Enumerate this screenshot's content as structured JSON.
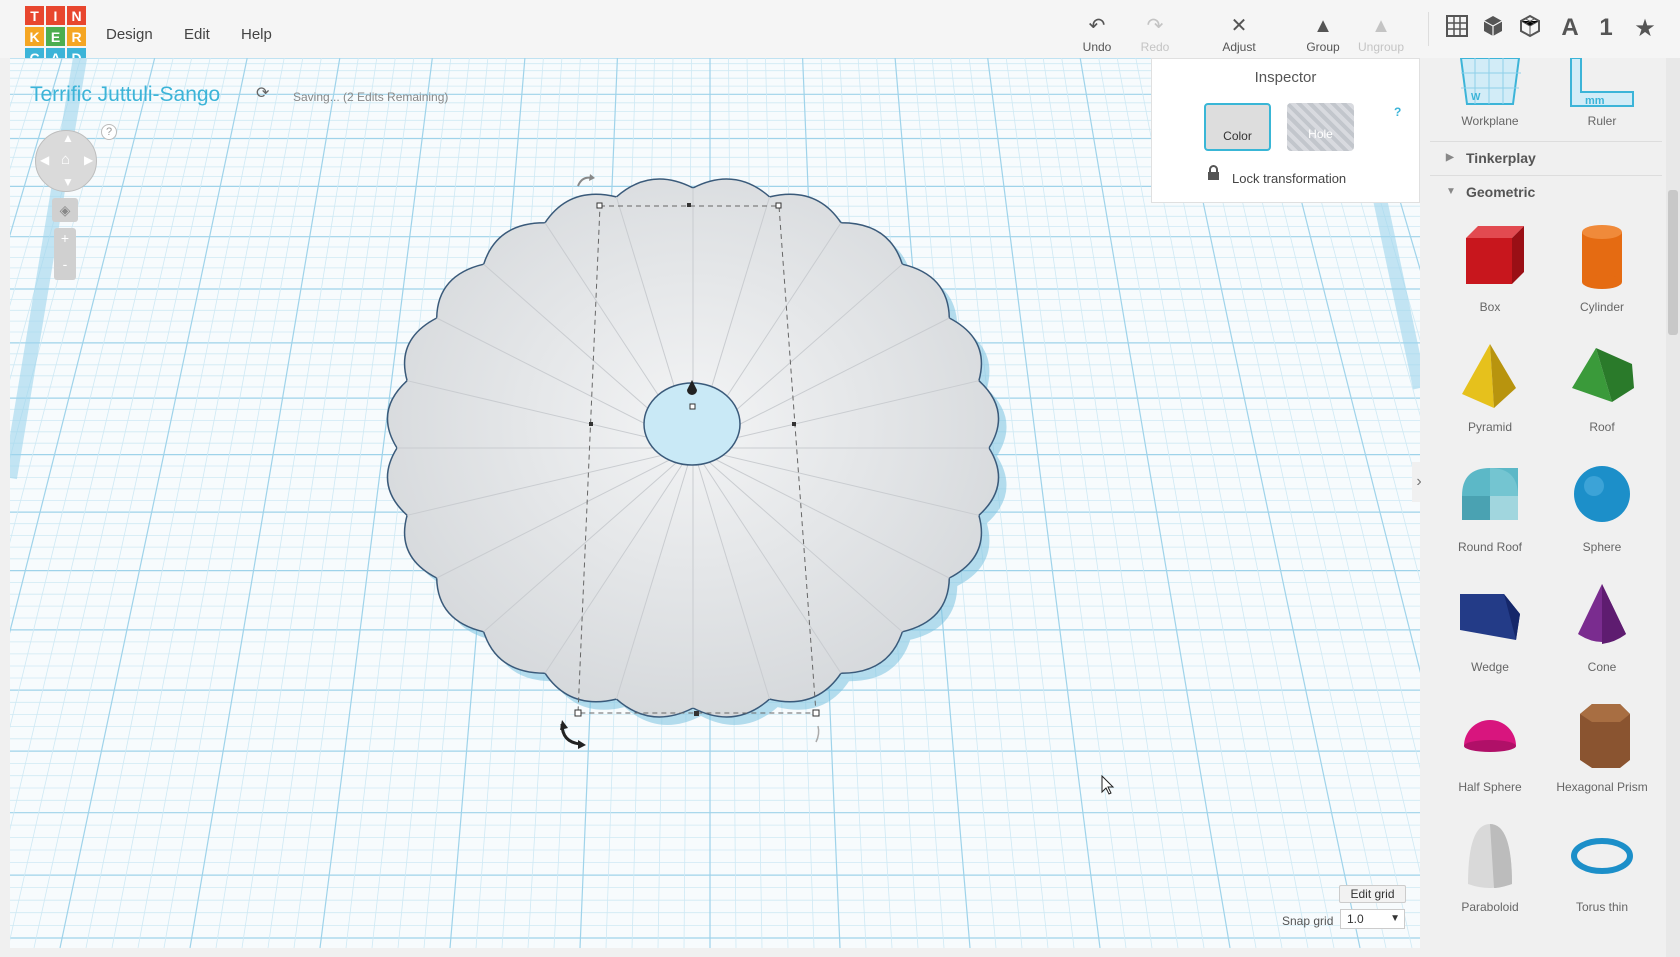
{
  "logo": {
    "letters": [
      "T",
      "I",
      "N",
      "K",
      "E",
      "R",
      "C",
      "A",
      "D"
    ],
    "colors": [
      "#e8462e",
      "#e8462e",
      "#e8462e",
      "#f5a623",
      "#4cae4f",
      "#f5a623",
      "#3cb4d8",
      "#3cb4d8",
      "#3cb4d8"
    ]
  },
  "menu": {
    "design": "Design",
    "edit": "Edit",
    "help": "Help"
  },
  "toolbar": {
    "undo": "Undo",
    "redo": "Redo",
    "adjust": "Adjust",
    "group": "Group",
    "ungroup": "Ungroup"
  },
  "view_buttons": {
    "text_A": "A",
    "text_1": "1",
    "star": "★"
  },
  "project": {
    "title": "Terrific Juttuli-Sango",
    "status": "Saving... (2 Edits Remaining)"
  },
  "nav": {
    "help": "?",
    "zoom_in": "+",
    "zoom_out": "-"
  },
  "inspector": {
    "title": "Inspector",
    "color_label": "Color",
    "hole_label": "Hole",
    "help": "?",
    "lock_label": "Lock transformation"
  },
  "grid": {
    "edit_grid": "Edit grid",
    "snap_label": "Snap grid",
    "snap_value": "1.0"
  },
  "panel": {
    "top_items": [
      {
        "label": "Workplane"
      },
      {
        "label": "Ruler"
      }
    ],
    "sections": [
      {
        "label": "Tinkerplay",
        "expanded": false
      },
      {
        "label": "Geometric",
        "expanded": true
      }
    ],
    "shapes": [
      {
        "label": "Box",
        "color": "#c8161d"
      },
      {
        "label": "Cylinder",
        "color": "#e56b12"
      },
      {
        "label": "Pyramid",
        "color": "#e6c11c"
      },
      {
        "label": "Roof",
        "color": "#3a9a3a"
      },
      {
        "label": "Round Roof",
        "color": "#5cb8c7"
      },
      {
        "label": "Sphere",
        "color": "#1c8fc9"
      },
      {
        "label": "Wedge",
        "color": "#233b87"
      },
      {
        "label": "Cone",
        "color": "#7a2c8f"
      },
      {
        "label": "Half Sphere",
        "color": "#d8157e"
      },
      {
        "label": "Hexagonal Prism",
        "color": "#8a5430"
      },
      {
        "label": "Paraboloid",
        "color": "#d9d9d9"
      },
      {
        "label": "Torus thin",
        "color": "#1c8fc9"
      }
    ]
  }
}
